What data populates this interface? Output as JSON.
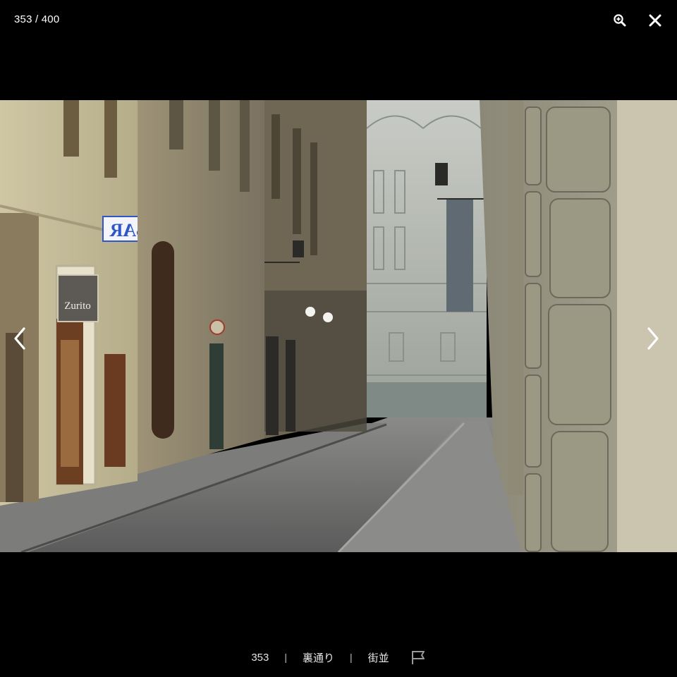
{
  "viewer": {
    "counter": "353 / 400"
  },
  "photo": {
    "sign_bar": "BAR",
    "sign_shop": "Zurito"
  },
  "caption": {
    "number": "353",
    "tag1": "裏通り",
    "tag2": "街並",
    "separator": "|"
  },
  "icons": {
    "zoom": "zoom-in-icon",
    "close": "close-icon",
    "prev": "chevron-left-icon",
    "next": "chevron-right-icon",
    "flag": "flag-icon"
  },
  "colors": {
    "background": "#000000",
    "text": "#ffffff",
    "caption_text": "#e6e6e6",
    "sign_blue": "#2f56c8"
  }
}
